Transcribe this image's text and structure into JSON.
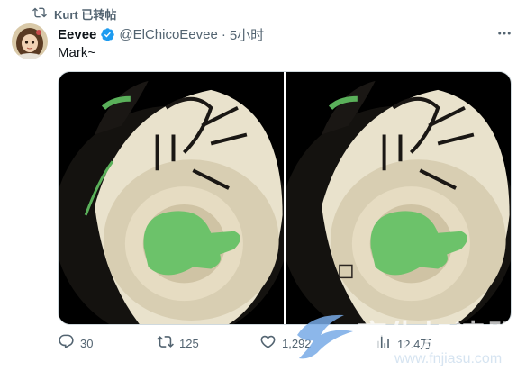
{
  "retweet": {
    "text": "Kurt 已转帖"
  },
  "tweet": {
    "name": "Eevee",
    "handle": "@ElChicoEevee",
    "dot": "·",
    "time": "5小时",
    "text": "Mark~"
  },
  "actions": {
    "replies": "30",
    "retweets": "125",
    "likes": "1,292",
    "views": "12.4万"
  },
  "watermark": {
    "brand": "齐牛加速器",
    "url": "www.fnjiasu.com"
  },
  "colors": {
    "verified": "#1d9bf0",
    "secondary_text": "#536471",
    "ball_cream": "#e9e2cc",
    "ball_dark": "#14120f",
    "nub_green": "#6cc26a"
  }
}
